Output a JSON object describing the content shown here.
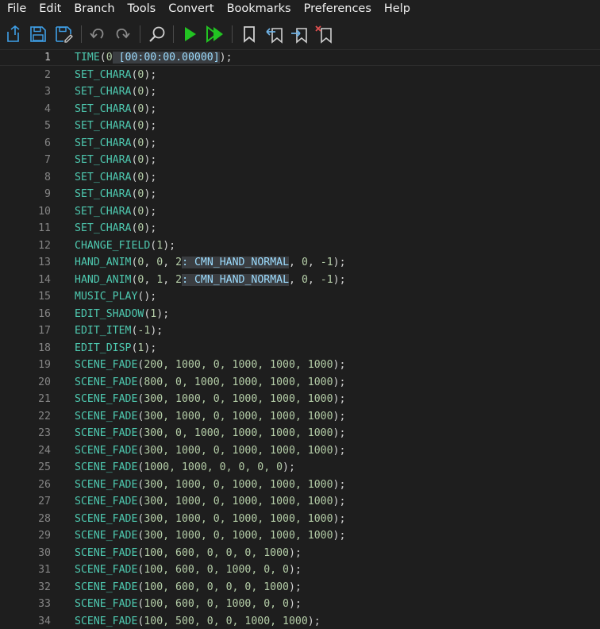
{
  "menu": [
    "File",
    "Edit",
    "Branch",
    "Tools",
    "Convert",
    "Bookmarks",
    "Preferences",
    "Help"
  ],
  "toolbar": {
    "buttons": [
      {
        "name": "open-file-icon",
        "color": "#3fa0e8"
      },
      {
        "name": "save-icon",
        "color": "#3fa0e8"
      },
      {
        "name": "save-as-icon",
        "color": "#3fa0e8"
      },
      {
        "name": "undo-icon",
        "color": "#8a8a8a"
      },
      {
        "name": "redo-icon",
        "color": "#8a8a8a"
      },
      {
        "name": "search-icon",
        "color": "#d0d0d0"
      },
      {
        "name": "run-icon",
        "color": "#22c322"
      },
      {
        "name": "run-to-icon",
        "color": "#22c322"
      },
      {
        "name": "bookmark-icon",
        "color": "#d0d0d0"
      },
      {
        "name": "bookmark-previous-icon",
        "color": "#6fb3e6"
      },
      {
        "name": "bookmark-next-icon",
        "color": "#6fb3e6"
      },
      {
        "name": "bookmark-clear-icon",
        "color": "#e05050"
      }
    ]
  },
  "editor": {
    "current_line": 1,
    "colors": {
      "function": "#4ec9b0",
      "number": "#b5cea8",
      "annotation_bg": "#3a3d41",
      "annotation_text": "#9cdcfe"
    },
    "lines": [
      {
        "n": "1",
        "fn": "TIME",
        "args": [
          {
            "t": "num",
            "v": "0"
          },
          {
            "t": "ann",
            "v": " [00:00:00.00000]"
          }
        ]
      },
      {
        "n": "2",
        "fn": "SET_CHARA",
        "args": [
          {
            "t": "num",
            "v": "0"
          }
        ]
      },
      {
        "n": "3",
        "fn": "SET_CHARA",
        "args": [
          {
            "t": "num",
            "v": "0"
          }
        ]
      },
      {
        "n": "4",
        "fn": "SET_CHARA",
        "args": [
          {
            "t": "num",
            "v": "0"
          }
        ]
      },
      {
        "n": "5",
        "fn": "SET_CHARA",
        "args": [
          {
            "t": "num",
            "v": "0"
          }
        ]
      },
      {
        "n": "6",
        "fn": "SET_CHARA",
        "args": [
          {
            "t": "num",
            "v": "0"
          }
        ]
      },
      {
        "n": "7",
        "fn": "SET_CHARA",
        "args": [
          {
            "t": "num",
            "v": "0"
          }
        ]
      },
      {
        "n": "8",
        "fn": "SET_CHARA",
        "args": [
          {
            "t": "num",
            "v": "0"
          }
        ]
      },
      {
        "n": "9",
        "fn": "SET_CHARA",
        "args": [
          {
            "t": "num",
            "v": "0"
          }
        ]
      },
      {
        "n": "10",
        "fn": "SET_CHARA",
        "args": [
          {
            "t": "num",
            "v": "0"
          }
        ]
      },
      {
        "n": "11",
        "fn": "SET_CHARA",
        "args": [
          {
            "t": "num",
            "v": "0"
          }
        ]
      },
      {
        "n": "12",
        "fn": "CHANGE_FIELD",
        "args": [
          {
            "t": "num",
            "v": "1"
          }
        ]
      },
      {
        "n": "13",
        "fn": "HAND_ANIM",
        "args": [
          {
            "t": "num",
            "v": "0"
          },
          {
            "t": "pn",
            "v": ", "
          },
          {
            "t": "num",
            "v": "0"
          },
          {
            "t": "pn",
            "v": ", "
          },
          {
            "t": "num",
            "v": "2"
          },
          {
            "t": "ann",
            "v": ": CMN_HAND_NORMAL"
          },
          {
            "t": "pn",
            "v": ", "
          },
          {
            "t": "num",
            "v": "0"
          },
          {
            "t": "pn",
            "v": ", "
          },
          {
            "t": "num",
            "v": "-1"
          }
        ]
      },
      {
        "n": "14",
        "fn": "HAND_ANIM",
        "args": [
          {
            "t": "num",
            "v": "0"
          },
          {
            "t": "pn",
            "v": ", "
          },
          {
            "t": "num",
            "v": "1"
          },
          {
            "t": "pn",
            "v": ", "
          },
          {
            "t": "num",
            "v": "2"
          },
          {
            "t": "ann",
            "v": ": CMN_HAND_NORMAL"
          },
          {
            "t": "pn",
            "v": ", "
          },
          {
            "t": "num",
            "v": "0"
          },
          {
            "t": "pn",
            "v": ", "
          },
          {
            "t": "num",
            "v": "-1"
          }
        ]
      },
      {
        "n": "15",
        "fn": "MUSIC_PLAY",
        "args": []
      },
      {
        "n": "16",
        "fn": "EDIT_SHADOW",
        "args": [
          {
            "t": "num",
            "v": "1"
          }
        ]
      },
      {
        "n": "17",
        "fn": "EDIT_ITEM",
        "args": [
          {
            "t": "num",
            "v": "-1"
          }
        ]
      },
      {
        "n": "18",
        "fn": "EDIT_DISP",
        "args": [
          {
            "t": "num",
            "v": "1"
          }
        ]
      },
      {
        "n": "19",
        "fn": "SCENE_FADE",
        "args": [
          {
            "t": "num",
            "v": "200, 1000, 0, 1000, 1000, 1000"
          }
        ]
      },
      {
        "n": "20",
        "fn": "SCENE_FADE",
        "args": [
          {
            "t": "num",
            "v": "800, 0, 1000, 1000, 1000, 1000"
          }
        ]
      },
      {
        "n": "21",
        "fn": "SCENE_FADE",
        "args": [
          {
            "t": "num",
            "v": "300, 1000, 0, 1000, 1000, 1000"
          }
        ]
      },
      {
        "n": "22",
        "fn": "SCENE_FADE",
        "args": [
          {
            "t": "num",
            "v": "300, 1000, 0, 1000, 1000, 1000"
          }
        ]
      },
      {
        "n": "23",
        "fn": "SCENE_FADE",
        "args": [
          {
            "t": "num",
            "v": "300, 0, 1000, 1000, 1000, 1000"
          }
        ]
      },
      {
        "n": "24",
        "fn": "SCENE_FADE",
        "args": [
          {
            "t": "num",
            "v": "300, 1000, 0, 1000, 1000, 1000"
          }
        ]
      },
      {
        "n": "25",
        "fn": "SCENE_FADE",
        "args": [
          {
            "t": "num",
            "v": "1000, 1000, 0, 0, 0, 0"
          }
        ]
      },
      {
        "n": "26",
        "fn": "SCENE_FADE",
        "args": [
          {
            "t": "num",
            "v": "300, 1000, 0, 1000, 1000, 1000"
          }
        ]
      },
      {
        "n": "27",
        "fn": "SCENE_FADE",
        "args": [
          {
            "t": "num",
            "v": "300, 1000, 0, 1000, 1000, 1000"
          }
        ]
      },
      {
        "n": "28",
        "fn": "SCENE_FADE",
        "args": [
          {
            "t": "num",
            "v": "300, 1000, 0, 1000, 1000, 1000"
          }
        ]
      },
      {
        "n": "29",
        "fn": "SCENE_FADE",
        "args": [
          {
            "t": "num",
            "v": "300, 1000, 0, 1000, 1000, 1000"
          }
        ]
      },
      {
        "n": "30",
        "fn": "SCENE_FADE",
        "args": [
          {
            "t": "num",
            "v": "100, 600, 0, 0, 0, 1000"
          }
        ]
      },
      {
        "n": "31",
        "fn": "SCENE_FADE",
        "args": [
          {
            "t": "num",
            "v": "100, 600, 0, 1000, 0, 0"
          }
        ]
      },
      {
        "n": "32",
        "fn": "SCENE_FADE",
        "args": [
          {
            "t": "num",
            "v": "100, 600, 0, 0, 0, 1000"
          }
        ]
      },
      {
        "n": "33",
        "fn": "SCENE_FADE",
        "args": [
          {
            "t": "num",
            "v": "100, 600, 0, 1000, 0, 0"
          }
        ]
      },
      {
        "n": "34",
        "fn": "SCENE_FADE",
        "args": [
          {
            "t": "num",
            "v": "100, 500, 0, 0, 1000, 1000"
          }
        ]
      }
    ]
  }
}
